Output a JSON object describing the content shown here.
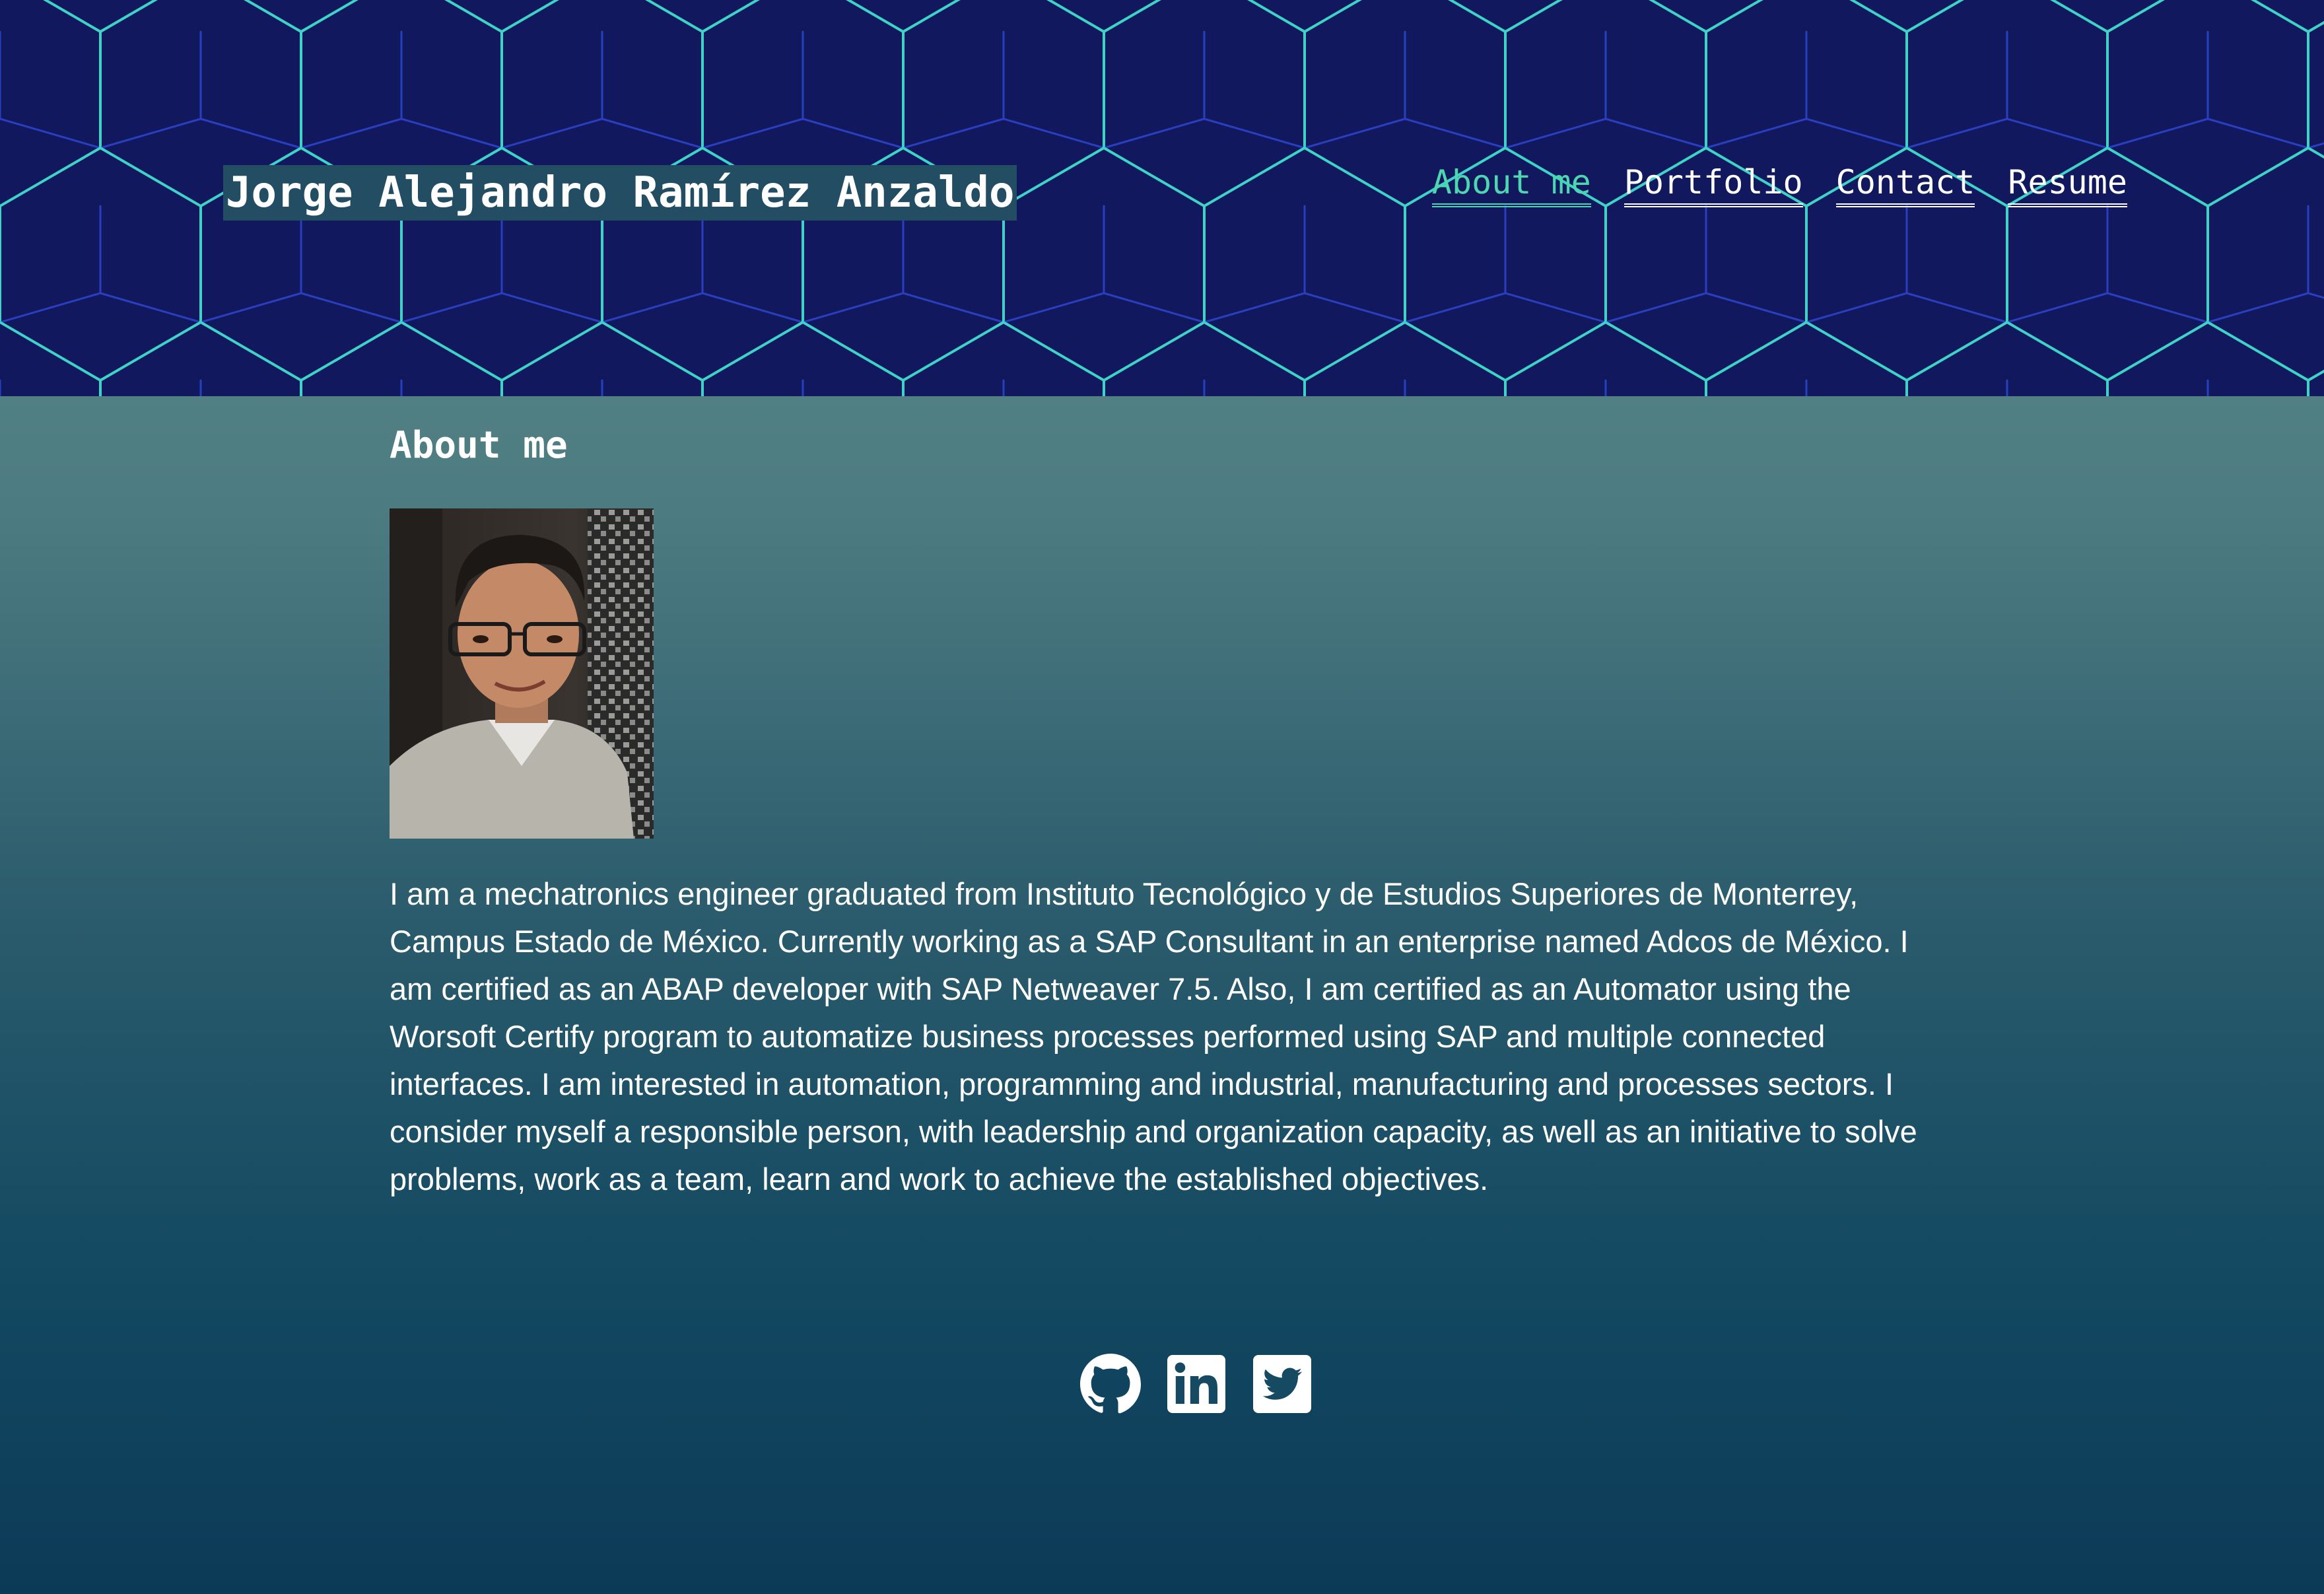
{
  "header": {
    "site_title": "Jorge Alejandro Ramírez Anzaldo",
    "nav": [
      {
        "label": "About me",
        "active": true
      },
      {
        "label": "Portfolio",
        "active": false
      },
      {
        "label": "Contact",
        "active": false
      },
      {
        "label": "Resume",
        "active": false
      }
    ]
  },
  "about": {
    "heading": "About me",
    "bio": "I am a mechatronics engineer graduated from Instituto Tecnológico y de Estudios Superiores de Monterrey, Campus Estado de México. Currently working as a SAP Consultant in an enterprise named Adcos de México. I am certified as an ABAP developer with SAP Netweaver 7.5. Also, I am certified as an Automator using the Worsoft Certify program to automatize business processes performed using SAP and multiple connected interfaces. I am interested in automation, programming and industrial, manufacturing and processes sectors. I consider myself a responsible person, with leadership and organization capacity, as well as an initiative to solve problems, work as a team, learn and work to achieve the established objectives."
  },
  "social": [
    {
      "icon": "github-icon"
    },
    {
      "icon": "linkedin-icon"
    },
    {
      "icon": "twitter-icon"
    }
  ],
  "colors": {
    "header_bg": "#12185e",
    "hex_line": "#3fd3c8",
    "hex_line_dim": "#2a3fc0",
    "nav_active": "#4ed6b0",
    "title_bg": "#234d62",
    "text": "#ffffff"
  }
}
